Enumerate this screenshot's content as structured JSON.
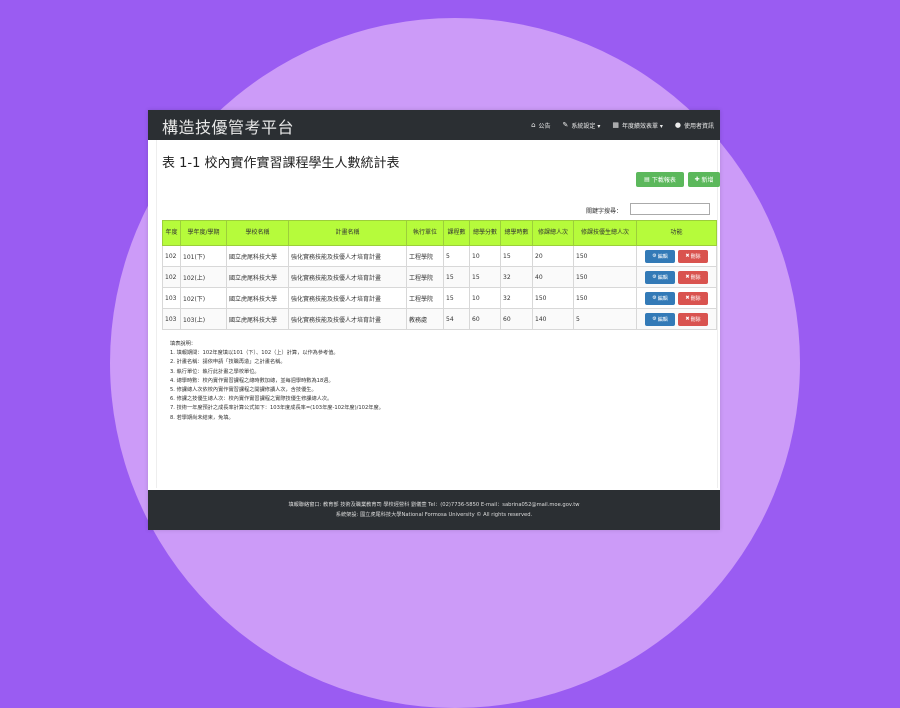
{
  "brand": "構造技優管考平台",
  "nav": [
    {
      "icon": "⌂",
      "label": "公告"
    },
    {
      "icon": "✎",
      "label": "系統設定 ▾"
    },
    {
      "icon": "▦",
      "label": "年度績效表單 ▾"
    },
    {
      "icon": "●",
      "label": "使用者資訊"
    }
  ],
  "page_title": "表 1-1 校內實作實習課程學生人數統計表",
  "buttons": {
    "download": "下載報表",
    "add": "新增"
  },
  "search": {
    "label": "關鍵字搜尋：",
    "placeholder": ""
  },
  "table": {
    "headers": [
      "年度",
      "學年度/學期",
      "學校名稱",
      "計畫名稱",
      "執行單位",
      "課程數",
      "總學分數",
      "總學時數",
      "修課總人次",
      "修課技優生總人次",
      "功能"
    ],
    "rows": [
      [
        "102",
        "101(下)",
        "國立虎尾科技大學",
        "強化實務技能及技優人才培育計畫",
        "工程學院",
        "5",
        "10",
        "15",
        "20",
        "150"
      ],
      [
        "102",
        "102(上)",
        "國立虎尾科技大學",
        "強化實務技能及技優人才培育計畫",
        "工程學院",
        "15",
        "15",
        "32",
        "40",
        "150"
      ],
      [
        "103",
        "102(下)",
        "國立虎尾科技大學",
        "強化實務技能及技優人才培育計畫",
        "工程學院",
        "15",
        "10",
        "32",
        "150",
        "150"
      ],
      [
        "103",
        "103(上)",
        "國立虎尾科技大學",
        "強化實務技能及技優人才培育計畫",
        "教務處",
        "54",
        "60",
        "60",
        "140",
        "5"
      ]
    ],
    "edit_label": "編輯",
    "delete_label": "刪除"
  },
  "notes": [
    "填表說明：",
    "1. 填報期間：102年度填以101（下）、102（上）計算，以作為參考值。",
    "2. 計畫名稱：請依申請「技職再造」之計畫名稱。",
    "3. 執行單位：執行此計畫之學校單位。",
    "4. 總學時數：校內實作實習課程之總時數加總，並每週學時數為18週。",
    "5. 修課總人次依校內實作實習課程之開課修讀人次，含技優生。",
    "6. 修課之技優生總人次：校內實作實習課程之實際技優生修課總人次。",
    "7. 技術一年度預計之成長率計算公式如下：103年度成長率=(103年度-102年度)/102年度。",
    "8. 若學期尚未結束，免填。"
  ],
  "footer": {
    "line1": "填報聯絡窗口: 教育部 技術及職業教育司 學校經營科 劉儀萱 Tel：(02)7736-5850 E-mail：sabrina052@mail.moe.gov.tw",
    "line2": "系統架設: 國立虎尾科技大學National Formosa University © All rights reserved."
  }
}
